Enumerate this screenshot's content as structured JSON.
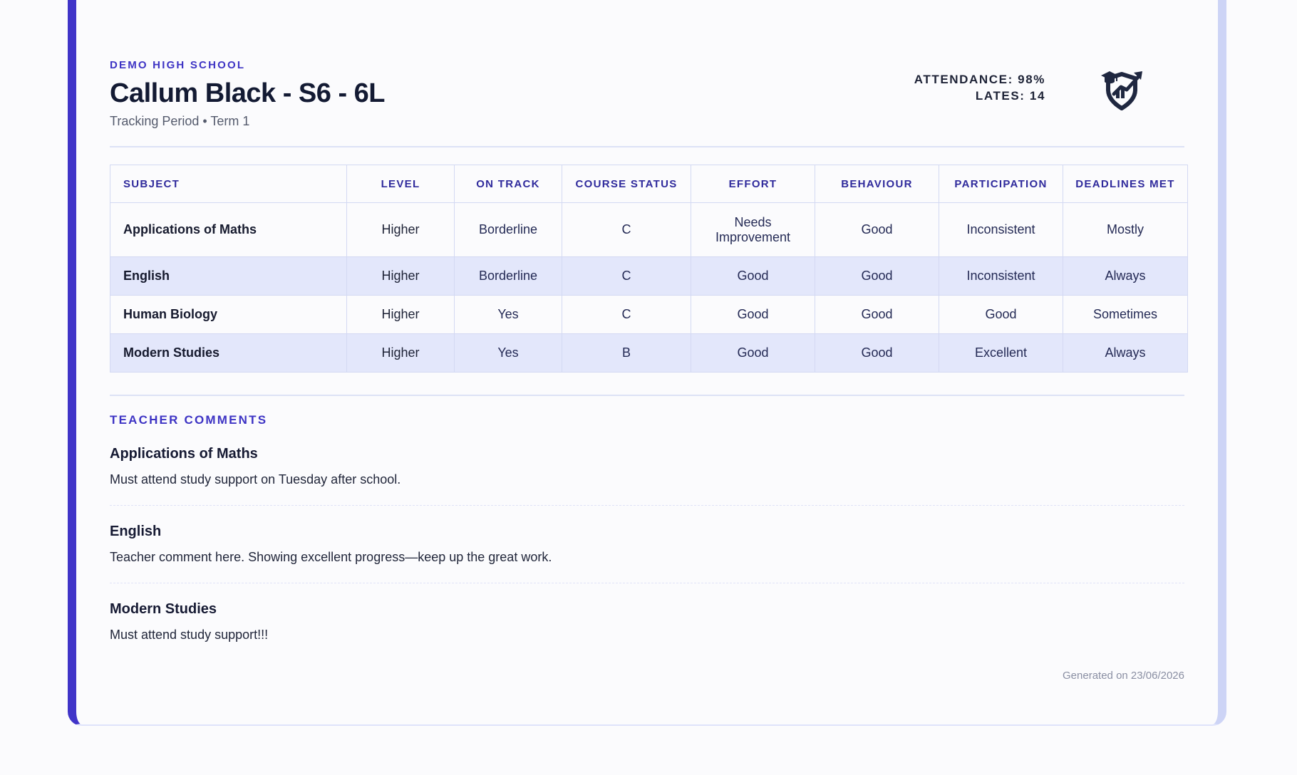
{
  "header": {
    "school": "DEMO HIGH SCHOOL",
    "student": "Callum Black - S6 - 6L",
    "period": "Tracking Period • Term 1",
    "attendance": "ATTENDANCE: 98%",
    "lates": "LATES: 14",
    "logo_icon": "shield-graduation-cap-chart-icon"
  },
  "table": {
    "columns": [
      "SUBJECT",
      "LEVEL",
      "ON TRACK",
      "COURSE STATUS",
      "EFFORT",
      "BEHAVIOUR",
      "PARTICIPATION",
      "DEADLINES MET"
    ],
    "rows": [
      {
        "subject": "Applications of Maths",
        "level": "Higher",
        "on_track": "Borderline",
        "course_status": "C",
        "effort": "Needs Improvement",
        "behaviour": "Good",
        "participation": "Inconsistent",
        "deadlines": "Mostly"
      },
      {
        "subject": "English",
        "level": "Higher",
        "on_track": "Borderline",
        "course_status": "C",
        "effort": "Good",
        "behaviour": "Good",
        "participation": "Inconsistent",
        "deadlines": "Always"
      },
      {
        "subject": "Human Biology",
        "level": "Higher",
        "on_track": "Yes",
        "course_status": "C",
        "effort": "Good",
        "behaviour": "Good",
        "participation": "Good",
        "deadlines": "Sometimes"
      },
      {
        "subject": "Modern Studies",
        "level": "Higher",
        "on_track": "Yes",
        "course_status": "B",
        "effort": "Good",
        "behaviour": "Good",
        "participation": "Excellent",
        "deadlines": "Always"
      }
    ]
  },
  "comments": {
    "heading": "TEACHER COMMENTS",
    "items": [
      {
        "subject": "Applications of Maths",
        "text": "Must attend study support on Tuesday after school."
      },
      {
        "subject": "English",
        "text": "Teacher comment here. Showing excellent progress—keep up the great work."
      },
      {
        "subject": "Modern Studies",
        "text": "Must attend study support!!!"
      }
    ]
  },
  "footer": {
    "generated": "Generated on 23/06/2026"
  },
  "colors": {
    "accent": "#4034c8",
    "accent_light": "#cdd4f6",
    "row_stripe": "#e3e7fb",
    "heading_text": "#131a33"
  }
}
